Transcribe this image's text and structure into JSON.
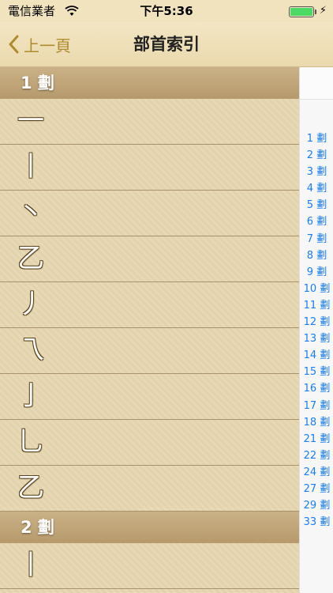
{
  "status": {
    "carrier": "電信業者",
    "time": "下午5:36"
  },
  "nav": {
    "back_label": "上一頁",
    "title": "部首索引"
  },
  "sections": [
    {
      "header": "1 劃",
      "rows": [
        "一",
        "丨",
        "丶",
        "乙",
        "丿",
        "乁",
        "亅",
        "乚",
        "乙"
      ]
    },
    {
      "header": "2 劃",
      "rows": [
        "丨"
      ]
    }
  ],
  "index": [
    "1 劃",
    "2 劃",
    "3 劃",
    "4 劃",
    "5 劃",
    "6 劃",
    "7 劃",
    "8 劃",
    "9 劃",
    "10 劃",
    "11 劃",
    "12 劃",
    "13 劃",
    "14 劃",
    "15 劃",
    "16 劃",
    "17 劃",
    "18 劃",
    "21 劃",
    "22 劃",
    "24 劃",
    "27 劃",
    "29 劃",
    "33 劃"
  ],
  "colors": {
    "accent": "#b08a2e",
    "index_text": "#1a7ef0",
    "section_header": "#bea177"
  },
  "icons": {
    "back": "chevron-left-icon",
    "wifi": "wifi-icon",
    "battery": "battery-icon",
    "charging": "bolt-icon"
  }
}
